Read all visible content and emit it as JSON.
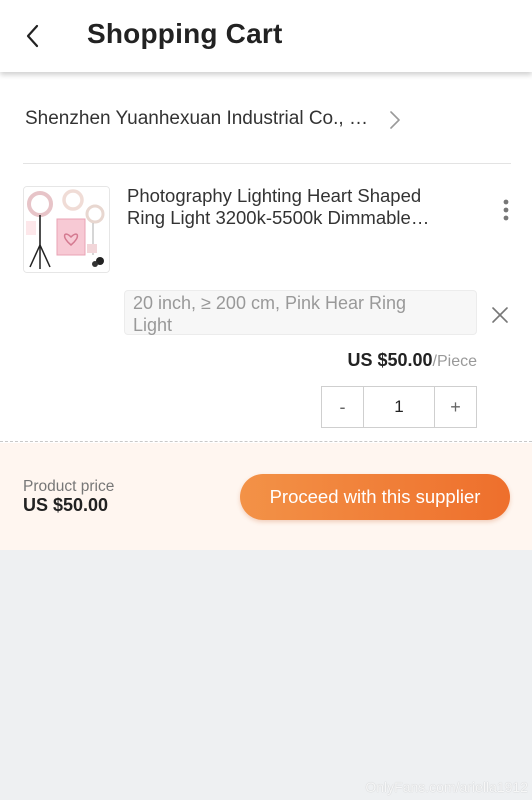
{
  "header": {
    "title": "Shopping Cart",
    "back_icon": "chevron-left-icon"
  },
  "supplier": {
    "name": "Shenzhen Yuanhexuan Industrial Co., …",
    "chevron_icon": "chevron-right-icon"
  },
  "product": {
    "title_line1": "Photography Lighting Heart Shaped",
    "title_line2": "Ring Light 3200k-5500k Dimmable…",
    "variant_line1": "20 inch, ≥ 200 cm, Pink Hear Ring",
    "variant_line2": "Light",
    "price": "US $50.00",
    "price_unit": "/Piece",
    "quantity": "1",
    "minus_label": "-",
    "plus_label": "+",
    "more_icon": "more-vertical-icon",
    "remove_icon": "close-icon"
  },
  "footer": {
    "label": "Product price",
    "total": "US $50.00",
    "proceed_label": "Proceed with this supplier"
  },
  "watermark": "OnlyFans.com/ariella1912",
  "colors": {
    "accent_start": "#f39247",
    "accent_end": "#ee6f2c",
    "footer_bg": "#fff6f0",
    "page_bg": "#eef0f2"
  }
}
